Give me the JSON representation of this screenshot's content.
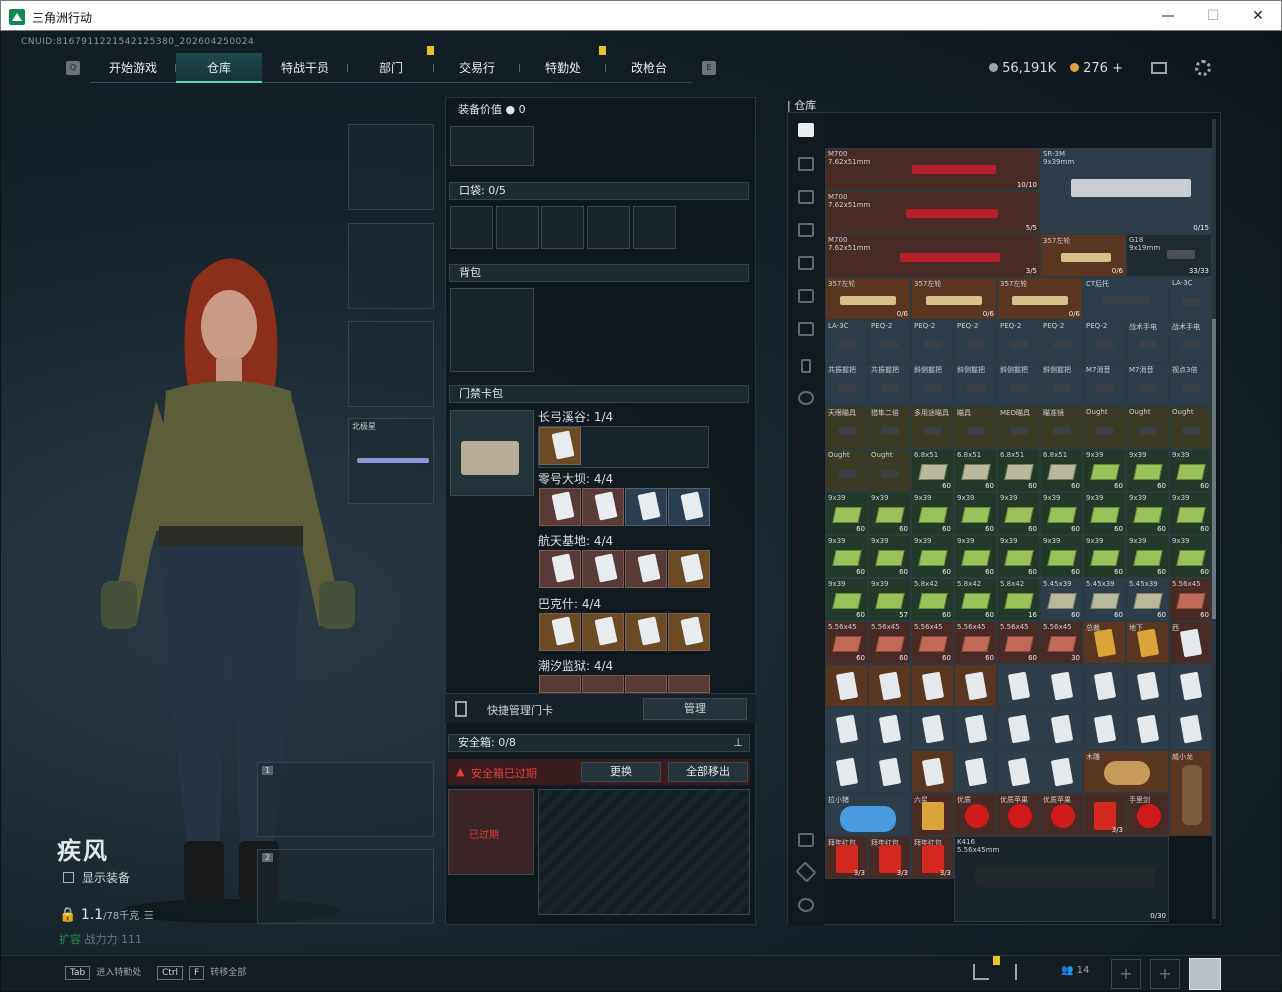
{
  "window": {
    "title": "三角洲行动",
    "min": "—",
    "max": "☐",
    "close": "✕"
  },
  "uid": "CNUID:8167911221542125380_202604250024",
  "tabs": [
    "开始游戏",
    "仓库",
    "特战干员",
    "部门",
    "交易行",
    "特勤处",
    "改枪台"
  ],
  "active_tab": "仓库",
  "currency": {
    "coins": "56,191K",
    "tickets": "276",
    "plus": "+"
  },
  "character": {
    "name": "疾风",
    "show_equipment": "显示装备",
    "weight": "1.1",
    "weight_max": "/78千克",
    "capacity": "扩容",
    "power": "战力力 111"
  },
  "weapon_slot": {
    "name": "北极星",
    "num1": "1",
    "num2": "2"
  },
  "mid": {
    "equip_value": "装备价值",
    "equip_value_num": "0",
    "pocket": "口袋:",
    "pocket_val": "0/5",
    "backpack": "背包",
    "keycard_pack": "门禁卡包",
    "groups": [
      {
        "label": "长弓溪谷: 1/4"
      },
      {
        "label": "零号大坝: 4/4"
      },
      {
        "label": "航天基地: 4/4"
      },
      {
        "label": "巴克什: 4/4"
      },
      {
        "label": "潮汐监狱: 4/4"
      }
    ],
    "quick_manage": "快捷管理门卡",
    "manage": "管理",
    "safebox": "安全箱:",
    "safebox_val": "0/8",
    "expired": "安全箱已过期",
    "replace": "更换",
    "move_all": "全部移出",
    "expired2": "已过期"
  },
  "warehouse": {
    "title": "仓库"
  },
  "items": {
    "m700": "M700",
    "m700cal": "7.62x51mm",
    "m700a": "10/10",
    "m700b": "5/5",
    "m700c": "3/5",
    "sr3m": "SR-3M",
    "sr3mcal": "9x39mm",
    "sr3mc": "0/15",
    "t357": "357左轮",
    "g18": "G18",
    "g18cal": "9x19mm",
    "g18c": "33/33",
    "r06": "0/6",
    "r1": [
      "357左轮",
      "357左轮",
      "357左轮",
      "CT后托",
      "LA-3C"
    ],
    "r2": [
      "LA-3C",
      "PEQ-2",
      "PEQ-2",
      "PEQ-2",
      "PEQ-2",
      "PEQ-2",
      "PEQ-2",
      "战术手电",
      "战术手电"
    ],
    "r3": [
      "共振握把",
      "共振握把",
      "斜侧握把",
      "斜侧握把",
      "斜侧握把",
      "斜侧握把",
      "M7消音",
      "M7消音",
      "视点3倍"
    ],
    "r4": [
      "天眼瞄具",
      "猎隼二倍",
      "多用途瞄具",
      "瞄具",
      "MEO瞄具",
      "瞄准镜",
      "Ought",
      "Ought",
      "Ought"
    ],
    "ammoRow": [
      [
        "Ought",
        ""
      ],
      [
        "Ought",
        ""
      ],
      [
        "6.8x51",
        "60"
      ],
      [
        "6.8x51",
        "60"
      ],
      [
        "6.8x51",
        "60"
      ],
      [
        "6.8x51",
        "60"
      ],
      [
        "9x39",
        "60"
      ],
      [
        "9x39",
        "60"
      ]
    ],
    "ammo939": "9x39",
    "c60": "60",
    "c57": "57",
    "c16": "16",
    "c30": "30",
    "row8": [
      [
        "9x39",
        "60"
      ],
      [
        "9x39",
        "57"
      ],
      [
        "5.8x42",
        "60"
      ],
      [
        "5.8x42",
        "60"
      ],
      [
        "5.8x42",
        "16"
      ],
      [
        "5.45x39",
        "60"
      ],
      [
        "5.45x39",
        "60"
      ],
      [
        "5.56x45",
        "60"
      ]
    ],
    "row9": [
      [
        "5.56x45",
        "60"
      ],
      [
        "5.56x45",
        "60"
      ],
      [
        "5.56x45",
        "60"
      ],
      [
        "5.56x45",
        "60"
      ],
      [
        "5.56x45",
        "60"
      ],
      [
        "5.56x45",
        "30"
      ],
      [
        "总裁",
        "",
        ""
      ],
      [
        "地下",
        "",
        ""
      ],
      [
        "西",
        ""
      ]
    ],
    "k416": "K416",
    "k416cal": "5.56x45mm",
    "k416c": "0/30",
    "c33": "3/3",
    "misc1": "拉小猪",
    "misc2": "六星",
    "misc3": "优质",
    "misc4": "优质苹果",
    "misc5": "木雕",
    "misc6": "威小龙",
    "misc7": "拜年红包",
    "misc8": "手里剑"
  },
  "bottom": {
    "k1": "Tab",
    "t1": "进入特勤处",
    "k2": "Ctrl",
    "k2b": "F",
    "t2": "转移全部",
    "friends": "14"
  }
}
